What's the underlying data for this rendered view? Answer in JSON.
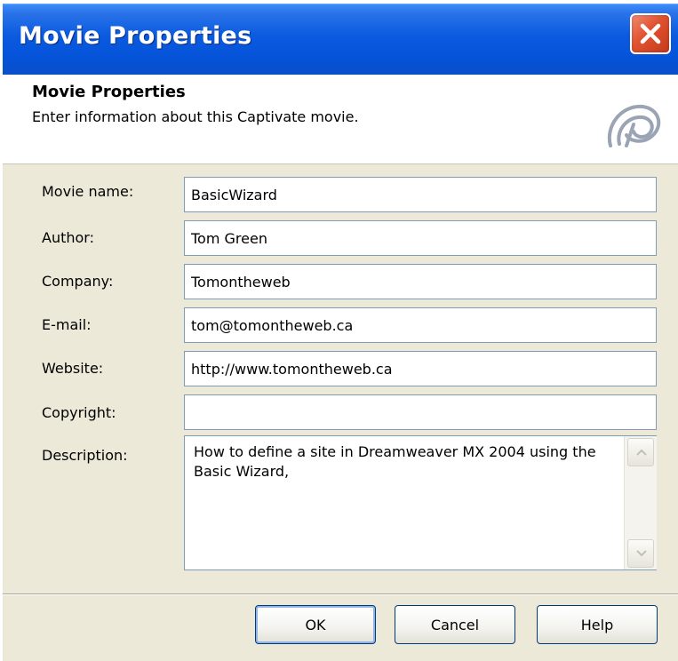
{
  "window": {
    "title": "Movie Properties"
  },
  "header": {
    "title": "Movie Properties",
    "subtitle": "Enter information about this Captivate movie.",
    "icon": "captivate-logo-icon"
  },
  "form": {
    "fields": [
      {
        "label": "Movie name:",
        "value": "BasicWizard"
      },
      {
        "label": "Author:",
        "value": "Tom Green"
      },
      {
        "label": "Company:",
        "value": "Tomontheweb"
      },
      {
        "label": "E-mail:",
        "value": "tom@tomontheweb.ca"
      },
      {
        "label": "Website:",
        "value": "http://www.tomontheweb.ca"
      },
      {
        "label": "Copyright:",
        "value": ""
      }
    ],
    "description": {
      "label": "Description:",
      "value": "How to define a site in Dreamweaver MX 2004 using the Basic Wizard,"
    }
  },
  "buttons": {
    "ok": "OK",
    "cancel": "Cancel",
    "help": "Help"
  },
  "colors": {
    "titlebar": "#0a5ae0",
    "dialog_bg": "#ece9d8",
    "close": "#e0512e",
    "field_border": "#7f9db9"
  }
}
